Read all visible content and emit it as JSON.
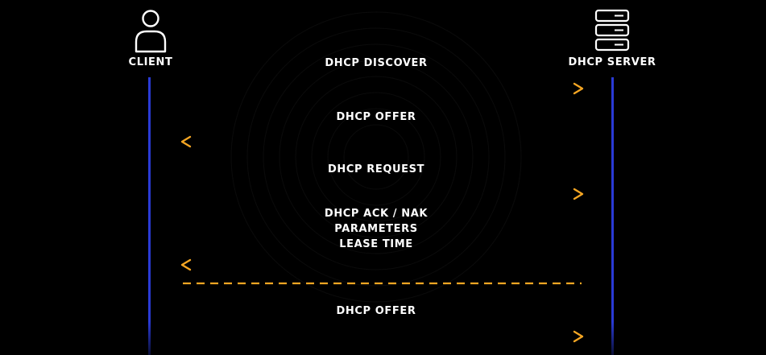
{
  "actors": {
    "client": {
      "label": "CLIENT",
      "icon": "person-icon"
    },
    "server": {
      "label": "DHCP SERVER",
      "icon": "server-icon"
    }
  },
  "messages": [
    {
      "lines": [
        "DHCP DISCOVER"
      ],
      "direction": "to-server"
    },
    {
      "lines": [
        "DHCP OFFER"
      ],
      "direction": "to-client"
    },
    {
      "lines": [
        "DHCP REQUEST"
      ],
      "direction": "to-server"
    },
    {
      "lines": [
        "DHCP ACK / NAK",
        "PARAMETERS",
        "LEASE TIME"
      ],
      "direction": "to-client"
    },
    {
      "lines": [
        "DHCP OFFER"
      ],
      "direction": "to-server"
    }
  ],
  "separator": {
    "style": "dashed"
  },
  "colors": {
    "background": "#000000",
    "arrow": "#f5a623",
    "lifeline": "#2a3bd6",
    "text": "#ffffff",
    "icon": "#ffffff"
  }
}
